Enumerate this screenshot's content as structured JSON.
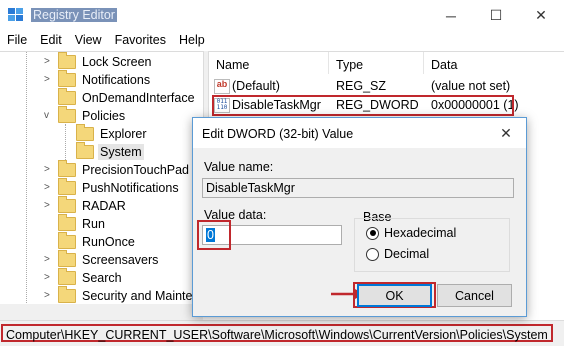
{
  "window": {
    "title": "Registry Editor",
    "minimize": "─",
    "maximize": "☐",
    "close": "✕"
  },
  "menu": [
    "File",
    "Edit",
    "View",
    "Favorites",
    "Help"
  ],
  "tree": {
    "items": [
      {
        "label": "Lock Screen",
        "expander": ">"
      },
      {
        "label": "Notifications",
        "expander": ">"
      },
      {
        "label": "OnDemandInterface",
        "expander": ""
      },
      {
        "label": "Policies",
        "expander": "v"
      },
      {
        "label": "Explorer",
        "expander": ""
      },
      {
        "label": "System",
        "expander": ""
      },
      {
        "label": "PrecisionTouchPad",
        "expander": ">"
      },
      {
        "label": "PushNotifications",
        "expander": ">"
      },
      {
        "label": "RADAR",
        "expander": ">"
      },
      {
        "label": "Run",
        "expander": ""
      },
      {
        "label": "RunOnce",
        "expander": ""
      },
      {
        "label": "Screensavers",
        "expander": ">"
      },
      {
        "label": "Search",
        "expander": ">"
      },
      {
        "label": "Security and Mainter",
        "expander": ">"
      }
    ]
  },
  "list": {
    "columns": [
      "Name",
      "Type",
      "Data"
    ],
    "rows": [
      {
        "name": "(Default)",
        "type": "REG_SZ",
        "data": "(value not set)",
        "icon": "string-value-icon",
        "glyph": "ab"
      },
      {
        "name": "DisableTaskMgr",
        "type": "REG_DWORD",
        "data": "0x00000001 (1)",
        "icon": "binary-value-icon",
        "glyph": "011 110"
      }
    ]
  },
  "dialog": {
    "title": "Edit DWORD (32-bit) Value",
    "close": "✕",
    "value_name_label": "Value name:",
    "value_name": "DisableTaskMgr",
    "value_data_label": "Value data:",
    "value_data": "0",
    "base_label": "Base",
    "base_options": [
      "Hexadecimal",
      "Decimal"
    ],
    "base_selected": "Hexadecimal",
    "ok": "OK",
    "cancel": "Cancel"
  },
  "status": {
    "path": "Computer\\HKEY_CURRENT_USER\\Software\\Microsoft\\Windows\\CurrentVersion\\Policies\\System"
  },
  "colors": {
    "highlight": "#c0282d",
    "accent": "#0078d7",
    "folder": "#f4d77a"
  }
}
